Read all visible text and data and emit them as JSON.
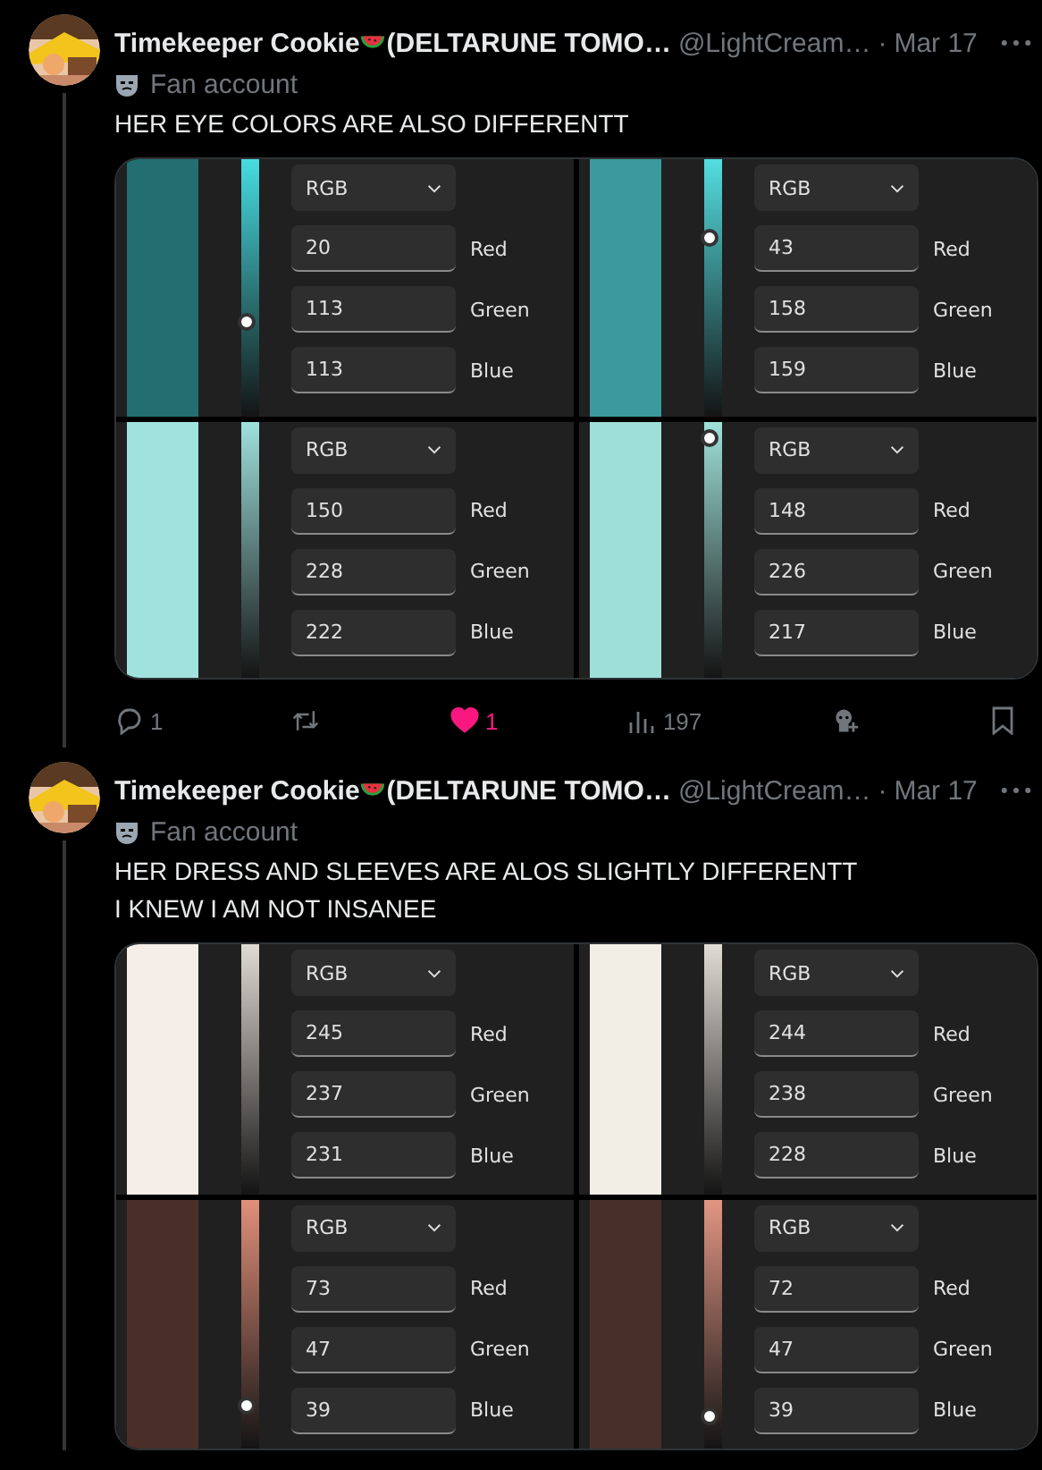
{
  "tweets": [
    {
      "author": {
        "name": "Timekeeper Cookie",
        "name_rest": "(DELTARUNE TOMO…",
        "handle": "@LightCream…",
        "separator": "·",
        "date": "Mar 17",
        "badge": "Fan account"
      },
      "text": "HER EYE COLORS ARE ALSO DIFFERENTT",
      "panels": [
        {
          "color": "#236e70",
          "level": 0.37,
          "mode": "RGB",
          "fields": [
            {
              "value": "20",
              "label": "Red"
            },
            {
              "value": "113",
              "label": "Green"
            },
            {
              "value": "113",
              "label": "Blue"
            }
          ]
        },
        {
          "color": "#3a9a9c",
          "level": 0.73,
          "mode": "RGB",
          "fields": [
            {
              "value": "43",
              "label": "Red"
            },
            {
              "value": "158",
              "label": "Green"
            },
            {
              "value": "159",
              "label": "Blue"
            }
          ]
        },
        {
          "color": "#a0e2de",
          "mode": "RGB",
          "fields": [
            {
              "value": "150",
              "label": "Red"
            },
            {
              "value": "228",
              "label": "Green"
            },
            {
              "value": "222",
              "label": "Blue"
            }
          ]
        },
        {
          "color": "#9ee0d8",
          "level": 1,
          "mode": "RGB",
          "fields": [
            {
              "value": "148",
              "label": "Red"
            },
            {
              "value": "226",
              "label": "Green"
            },
            {
              "value": "217",
              "label": "Blue"
            }
          ]
        }
      ],
      "actions": {
        "replies": "1",
        "likes": "1",
        "liked": true,
        "views": "197"
      }
    },
    {
      "author": {
        "name": "Timekeeper Cookie",
        "name_rest": "(DELTARUNE TOMO…",
        "handle": "@LightCream…",
        "separator": "·",
        "date": "Mar 17",
        "badge": "Fan account"
      },
      "text": "HER DRESS AND SLEEVES ARE ALOS SLIGHTLY DIFFERENTT\nI KNEW I AM NOT INSANEE",
      "panels": [
        {
          "color": "#f5ede7",
          "mode": "RGB",
          "fields": [
            {
              "value": "245",
              "label": "Red"
            },
            {
              "value": "237",
              "label": "Green"
            },
            {
              "value": "231",
              "label": "Blue"
            }
          ]
        },
        {
          "color": "#f2ede5",
          "mode": "RGB",
          "fields": [
            {
              "value": "244",
              "label": "Red"
            },
            {
              "value": "238",
              "label": "Green"
            },
            {
              "value": "228",
              "label": "Blue"
            }
          ]
        },
        {
          "color": "#4a2f28",
          "level": 0.15,
          "mode": "RGB",
          "fields": [
            {
              "value": "73",
              "label": "Red"
            },
            {
              "value": "47",
              "label": "Green"
            },
            {
              "value": "39",
              "label": "Blue"
            }
          ]
        },
        {
          "color": "#48302a",
          "level": 0.1,
          "mode": "RGB",
          "fields": [
            {
              "value": "72",
              "label": "Red"
            },
            {
              "value": "47",
              "label": "Green"
            },
            {
              "value": "39",
              "label": "Blue"
            }
          ]
        }
      ]
    }
  ]
}
